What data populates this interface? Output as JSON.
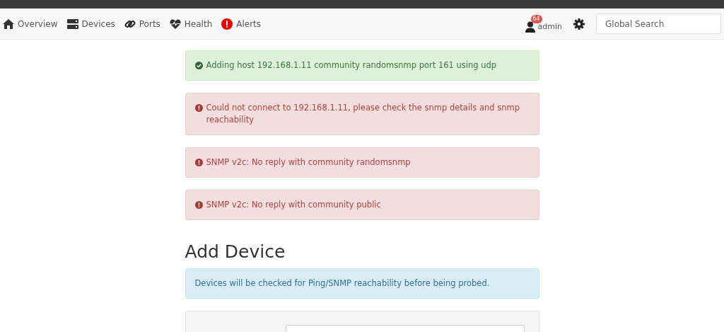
{
  "nav": {
    "items": [
      {
        "label": "Overview"
      },
      {
        "label": "Devices"
      },
      {
        "label": "Ports"
      },
      {
        "label": "Health"
      },
      {
        "label": "Alerts"
      }
    ],
    "user": {
      "badge": "64",
      "name": "admin"
    },
    "search": {
      "placeholder": "Global Search"
    }
  },
  "messages": [
    {
      "kind": "success",
      "text": "Adding host 192.168.1.11 community randomsnmp port 161 using udp"
    },
    {
      "kind": "danger",
      "text": "Could not connect to 192.168.1.11, please check the snmp details and snmp reachability"
    },
    {
      "kind": "danger",
      "text": "SNMP v2c: No reply with community randomsnmp"
    },
    {
      "kind": "danger",
      "text": "SNMP v2c: No reply with community public"
    }
  ],
  "heading": "Add Device",
  "info": "Devices will be checked for Ping/SNMP reachability before being probed."
}
